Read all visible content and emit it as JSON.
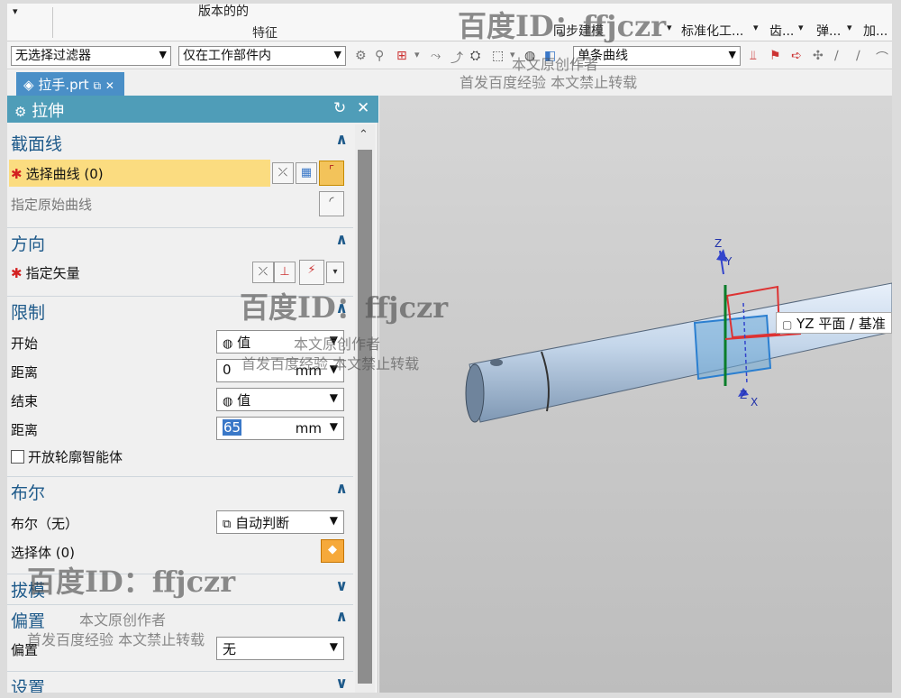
{
  "ribbon": {
    "top_label": "版本的的",
    "group_label": "特征",
    "sync_modeling": "同步建模",
    "std_part": "标准化工...",
    "gear": "齿...",
    "spring": "弹...",
    "add": "加..."
  },
  "toolbar": {
    "filter": "无选择过滤器",
    "scope": "仅在工作部件内",
    "curve_rule": "单条曲线"
  },
  "file_tab": {
    "label": "拉手.prt"
  },
  "dialog": {
    "title": "拉伸",
    "sections": {
      "section_curve": {
        "title": "截面线",
        "select_curve": "选择曲线 (0)",
        "specify_origin": "指定原始曲线"
      },
      "direction": {
        "title": "方向",
        "specify_vector": "指定矢量"
      },
      "limits": {
        "title": "限制",
        "start_label": "开始",
        "start_value": "值",
        "distance_label": "距离",
        "start_distance": "0",
        "unit": "mm",
        "end_label": "结束",
        "end_value": "值",
        "end_distance": "65",
        "open_profile": "开放轮廓智能体"
      },
      "boolean": {
        "title": "布尔",
        "boolean_label": "布尔（无）",
        "boolean_value": "自动判断",
        "select_body": "选择体 (0)"
      },
      "draft": {
        "title": "拔模"
      },
      "offset": {
        "title": "偏置",
        "offset_label": "偏置",
        "offset_value": "无"
      },
      "settings": {
        "title": "设置"
      }
    }
  },
  "viewport": {
    "tooltip": "YZ 平面 / 基准",
    "axis_z": "Z",
    "axis_y": "Y",
    "axis_x": "X",
    "axis_z2": "Z"
  },
  "watermark": {
    "brand": "百度ID：ffjczr",
    "line1": "本文原创作者",
    "line2": "首发百度经验  本文禁止转载"
  },
  "colors": {
    "title_bar": "#4f9db8",
    "highlight": "#fbdc80",
    "section_title": "#1e5a8a",
    "tab": "#4a8fc7"
  }
}
